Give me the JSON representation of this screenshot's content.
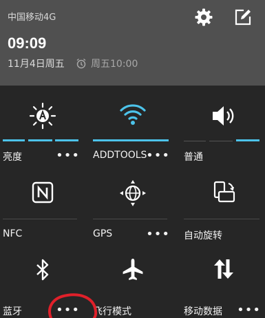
{
  "status": {
    "carrier": "中国移动4G",
    "time": "09:09",
    "date": "11月4日周五",
    "alarm": "周五10:00"
  },
  "tiles": [
    {
      "label": "亮度",
      "icon": "brightness-auto-icon"
    },
    {
      "label": "ADDTOOLS",
      "icon": "wifi-icon"
    },
    {
      "label": "普通",
      "icon": "volume-icon"
    },
    {
      "label": "NFC",
      "icon": "nfc-icon"
    },
    {
      "label": "GPS",
      "icon": "gps-icon"
    },
    {
      "label": "自动旋转",
      "icon": "auto-rotate-icon"
    },
    {
      "label": "蓝牙",
      "icon": "bluetooth-icon"
    },
    {
      "label": "飞行模式",
      "icon": "airplane-icon"
    },
    {
      "label": "移动数据",
      "icon": "mobile-data-icon"
    }
  ],
  "more_glyph": "•••",
  "colors": {
    "accent": "#4cc3ea",
    "annotation": "#e0202a"
  }
}
